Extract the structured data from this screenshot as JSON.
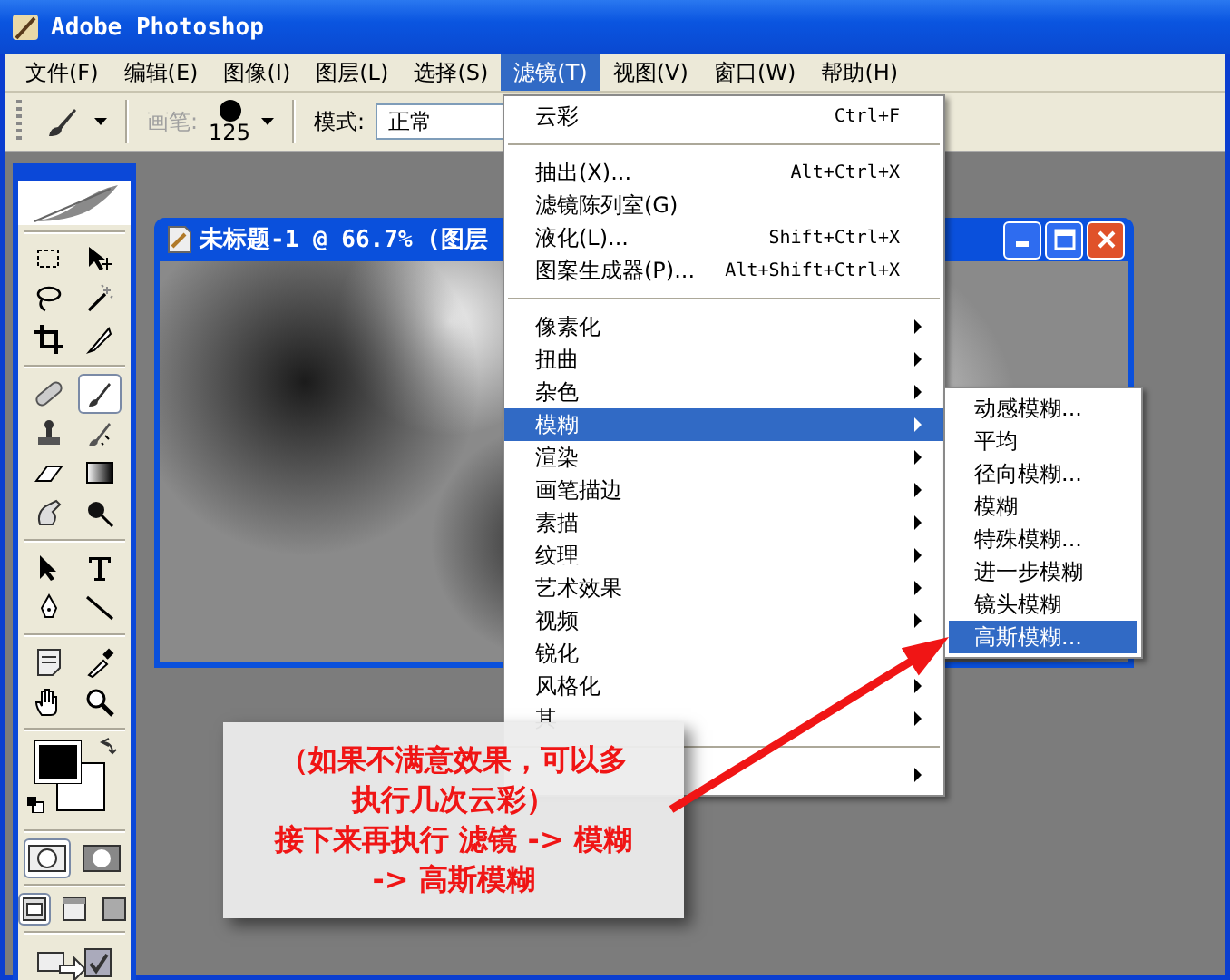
{
  "window": {
    "title": "Adobe Photoshop"
  },
  "menubar": [
    {
      "label": "文件(F)",
      "selected": false
    },
    {
      "label": "编辑(E)",
      "selected": false
    },
    {
      "label": "图像(I)",
      "selected": false
    },
    {
      "label": "图层(L)",
      "selected": false
    },
    {
      "label": "选择(S)",
      "selected": false
    },
    {
      "label": "滤镜(T)",
      "selected": true
    },
    {
      "label": "视图(V)",
      "selected": false
    },
    {
      "label": "窗口(W)",
      "selected": false
    },
    {
      "label": "帮助(H)",
      "selected": false
    }
  ],
  "options_bar": {
    "brush_label": "画笔:",
    "brush_size": "125",
    "mode_label": "模式:",
    "mode_value": "正常"
  },
  "toolbox": {
    "tools": [
      {
        "selected": false
      },
      {
        "selected": false
      },
      {
        "selected": false
      },
      {
        "selected": false
      },
      {
        "selected": false
      },
      {
        "selected": false
      },
      {
        "selected": false
      },
      {
        "selected": true
      },
      {
        "selected": false
      },
      {
        "selected": false
      },
      {
        "selected": false
      },
      {
        "selected": false
      },
      {
        "selected": false
      },
      {
        "selected": false
      },
      {
        "selected": false
      },
      {
        "selected": false
      },
      {
        "selected": false
      },
      {
        "selected": false
      },
      {
        "selected": false
      },
      {
        "selected": false
      },
      {
        "selected": false
      },
      {
        "selected": false
      }
    ]
  },
  "document": {
    "title": "未标题-1 @ 66.7% (图层"
  },
  "filter_menu": {
    "items": [
      {
        "kind": "item",
        "label": "云彩",
        "shortcut": "Ctrl+F",
        "selected": false
      },
      {
        "kind": "separator"
      },
      {
        "kind": "item",
        "label": "抽出(X)...",
        "shortcut": "Alt+Ctrl+X",
        "selected": false
      },
      {
        "kind": "item",
        "label": "滤镜陈列室(G)",
        "selected": false
      },
      {
        "kind": "item",
        "label": "液化(L)...",
        "shortcut": "Shift+Ctrl+X",
        "selected": false
      },
      {
        "kind": "item",
        "label": "图案生成器(P)...",
        "shortcut": "Alt+Shift+Ctrl+X",
        "selected": false
      },
      {
        "kind": "separator"
      },
      {
        "kind": "submenu",
        "label": "像素化",
        "selected": false
      },
      {
        "kind": "submenu",
        "label": "扭曲",
        "selected": false
      },
      {
        "kind": "submenu",
        "label": "杂色",
        "selected": false
      },
      {
        "kind": "submenu",
        "label": "模糊",
        "selected": true
      },
      {
        "kind": "submenu",
        "label": "渲染",
        "selected": false
      },
      {
        "kind": "submenu",
        "label": "画笔描边",
        "selected": false
      },
      {
        "kind": "submenu",
        "label": "素描",
        "selected": false
      },
      {
        "kind": "submenu",
        "label": "纹理",
        "selected": false
      },
      {
        "kind": "submenu",
        "label": "艺术效果",
        "selected": false
      },
      {
        "kind": "submenu",
        "label": "视频",
        "selected": false
      },
      {
        "kind": "submenu",
        "label": "锐化",
        "selected": false
      },
      {
        "kind": "submenu",
        "label": "风格化",
        "selected": false
      },
      {
        "kind": "submenu",
        "label": "其",
        "selected": false
      },
      {
        "kind": "separator"
      },
      {
        "kind": "submenu",
        "selected": false
      }
    ]
  },
  "blur_submenu": {
    "items": [
      {
        "label": "动感模糊...",
        "selected": false
      },
      {
        "label": "平均",
        "selected": false
      },
      {
        "label": "径向模糊...",
        "selected": false
      },
      {
        "label": "模糊",
        "selected": false
      },
      {
        "label": "特殊模糊...",
        "selected": false
      },
      {
        "label": "进一步模糊",
        "selected": false
      },
      {
        "label": "镜头模糊",
        "selected": false
      },
      {
        "label": "高斯模糊...",
        "selected": true
      }
    ]
  },
  "callout": {
    "lines": [
      "（如果不满意效果，可以多",
      "执行几次云彩）",
      "接下来再执行 滤镜 -> 模糊",
      "-> 高斯模糊"
    ]
  }
}
